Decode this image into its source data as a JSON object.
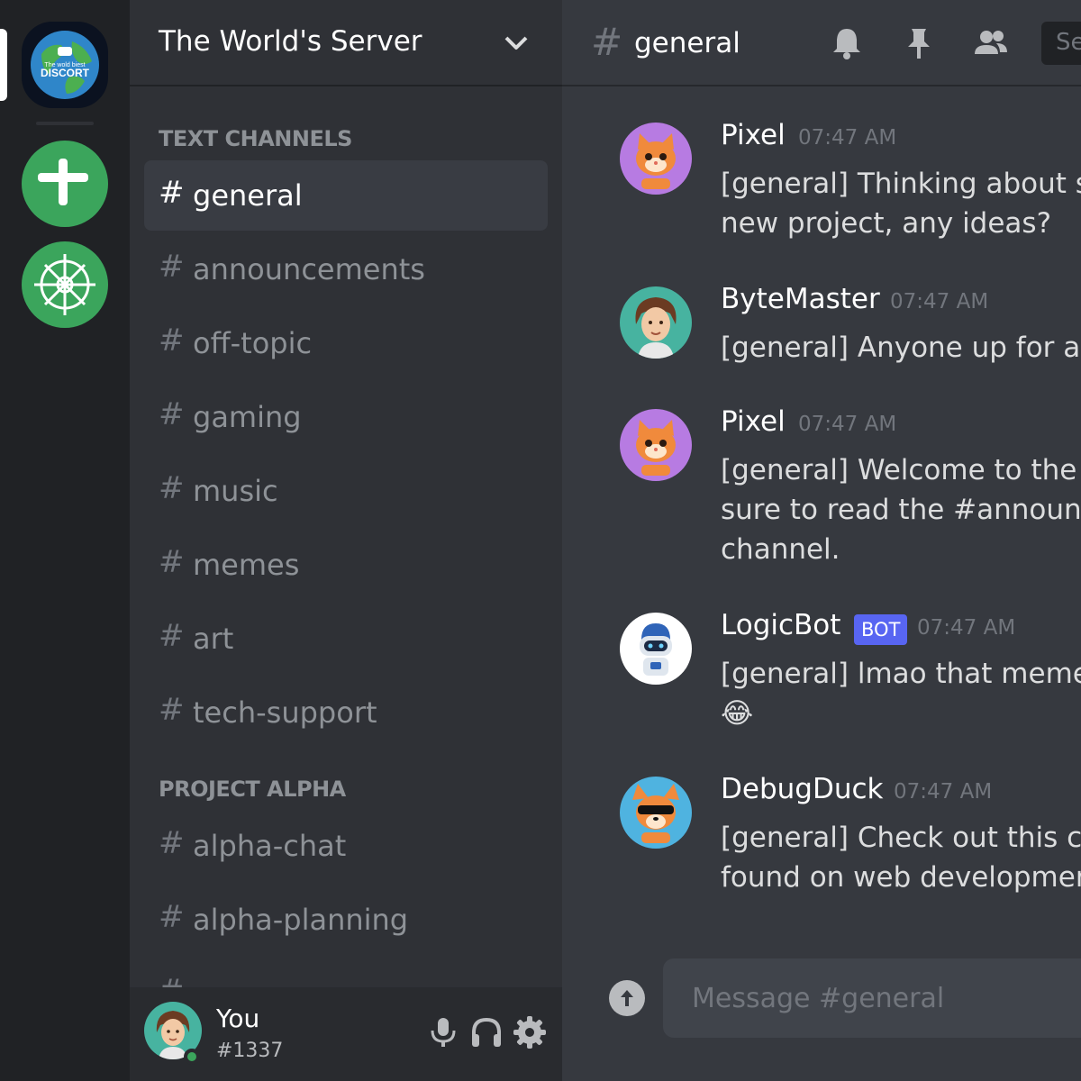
{
  "servers": {
    "world": {
      "logo_line1": "The wold biest",
      "logo_line2": "DISCORT"
    }
  },
  "sidebar": {
    "server_name": "The World's Server",
    "categories": [
      "TEXT CHANNELS",
      "PROJECT ALPHA"
    ],
    "hash": "#",
    "channels": [
      {
        "name": "general",
        "active": true
      },
      {
        "name": "announcements"
      },
      {
        "name": "off-topic"
      },
      {
        "name": "gaming"
      },
      {
        "name": "music"
      },
      {
        "name": "memes"
      },
      {
        "name": "art"
      },
      {
        "name": "tech-support"
      },
      {
        "name": "alpha-chat"
      },
      {
        "name": "alpha-planning"
      }
    ]
  },
  "user": {
    "name": "You",
    "tag": "#1337"
  },
  "header": {
    "hash": "#",
    "channel": "general",
    "search_placeholder": "Se"
  },
  "messages": [
    {
      "author": "Pixel",
      "time": "07:47 AM",
      "text": "[general] Thinking about starting a new project, any ideas?"
    },
    {
      "author": "ByteMaster",
      "time": "07:47 AM",
      "text": "[general] Anyone up for a game?"
    },
    {
      "author": "Pixel",
      "time": "07:47 AM",
      "text": "[general] Welcome to the server! Be sure to read the #announcements channel."
    },
    {
      "author": "LogicBot",
      "badge": "BOT",
      "time": "07:47 AM",
      "text": "[general] lmao that meme",
      "emoji": "😂"
    },
    {
      "author": "DebugDuck",
      "time": "07:47 AM",
      "text": "[general] Check out this cool article I found on web development"
    }
  ],
  "composer": {
    "placeholder": "Message #general"
  },
  "colors": {
    "accent": "#5865f2",
    "online": "#3ba55c",
    "bg": "#36393f"
  }
}
